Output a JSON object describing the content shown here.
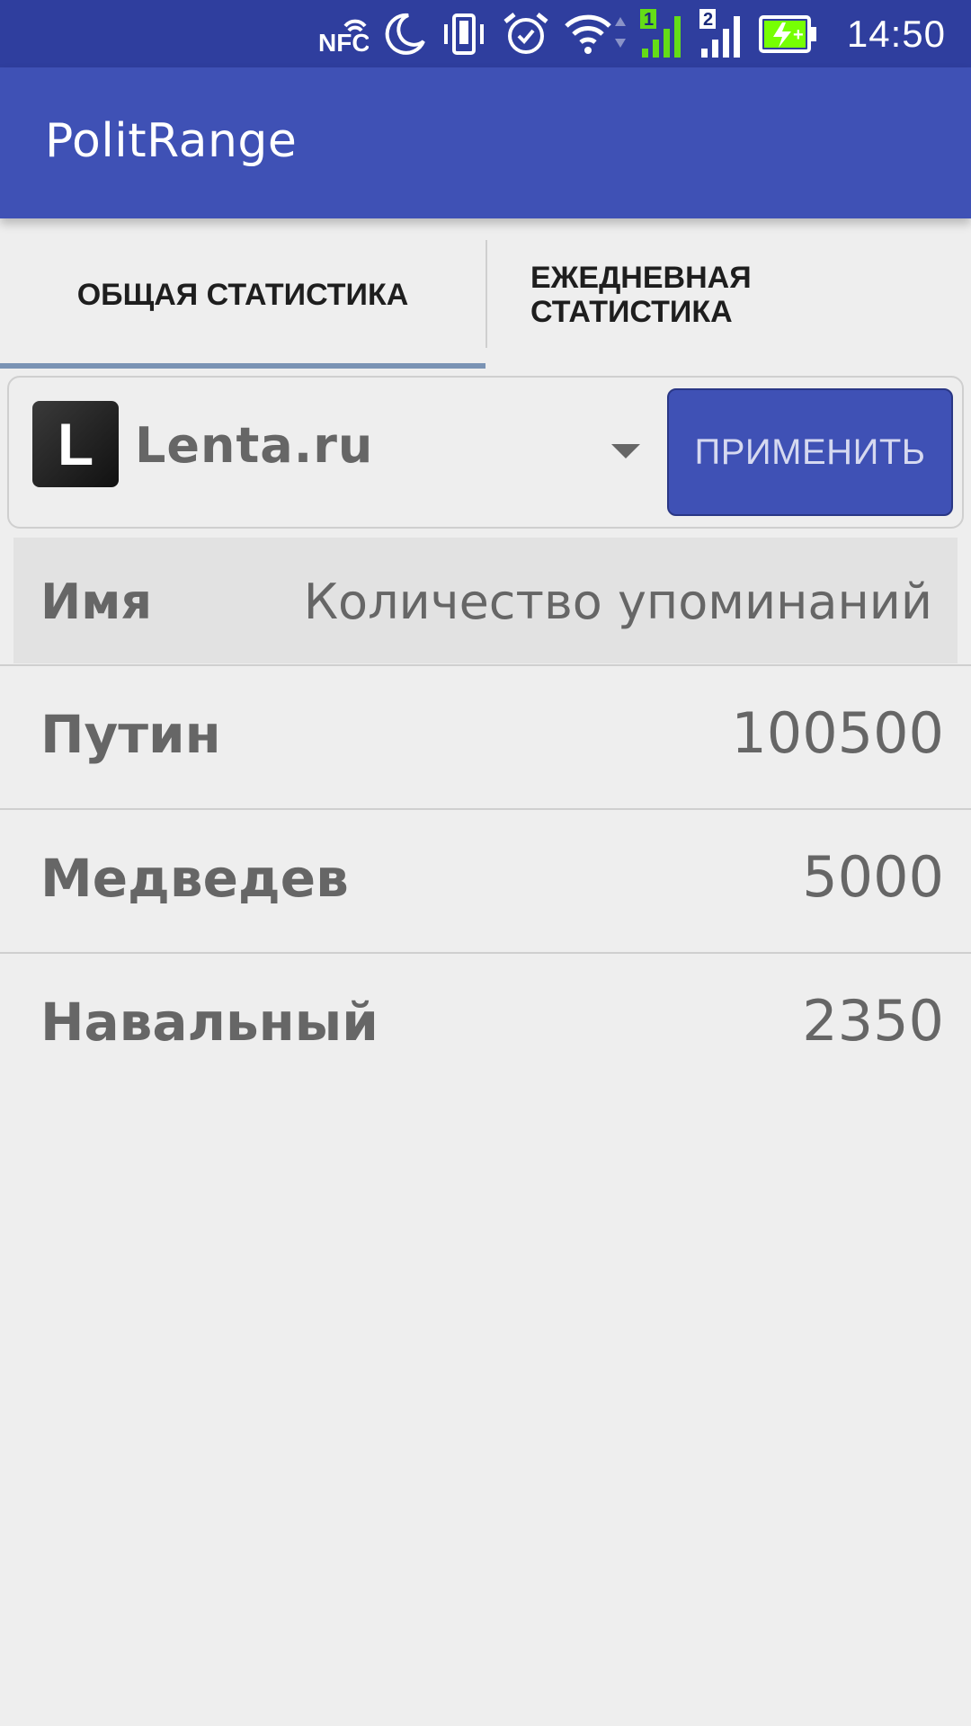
{
  "status_bar": {
    "time": "14:50",
    "icons": [
      "nfc-icon",
      "moon-icon",
      "vibrate-icon",
      "alarm-icon",
      "wifi-icon",
      "signal-sim1-icon",
      "signal-sim2-icon",
      "battery-charging-icon"
    ],
    "sim1_label": "1",
    "sim2_label": "2",
    "nfc_label": "NFC"
  },
  "app_bar": {
    "title": "PolitRange"
  },
  "tabs": [
    {
      "label": "ОБЩАЯ СТАТИСТИКА",
      "selected": true
    },
    {
      "label": "ЕЖЕДНЕВНАЯ СТАТИСТИКА",
      "selected": false
    }
  ],
  "filter": {
    "source_logo_letter": "L",
    "source_name": "Lenta.ru",
    "apply_label": "ПРИМЕНИТЬ"
  },
  "table": {
    "headers": {
      "name": "Имя",
      "count": "Количество упоминаний"
    },
    "rows": [
      {
        "name": "Путин",
        "count": "100500"
      },
      {
        "name": "Медведев",
        "count": "5000"
      },
      {
        "name": "Навальный",
        "count": "2350"
      }
    ]
  },
  "colors": {
    "status_bar": "#2f3e9e",
    "app_bar": "#3f51b5",
    "tab_indicator": "#7a93b4",
    "background": "#eeeeee",
    "battery_green": "#76ff03",
    "signal_green": "#64dd17"
  }
}
